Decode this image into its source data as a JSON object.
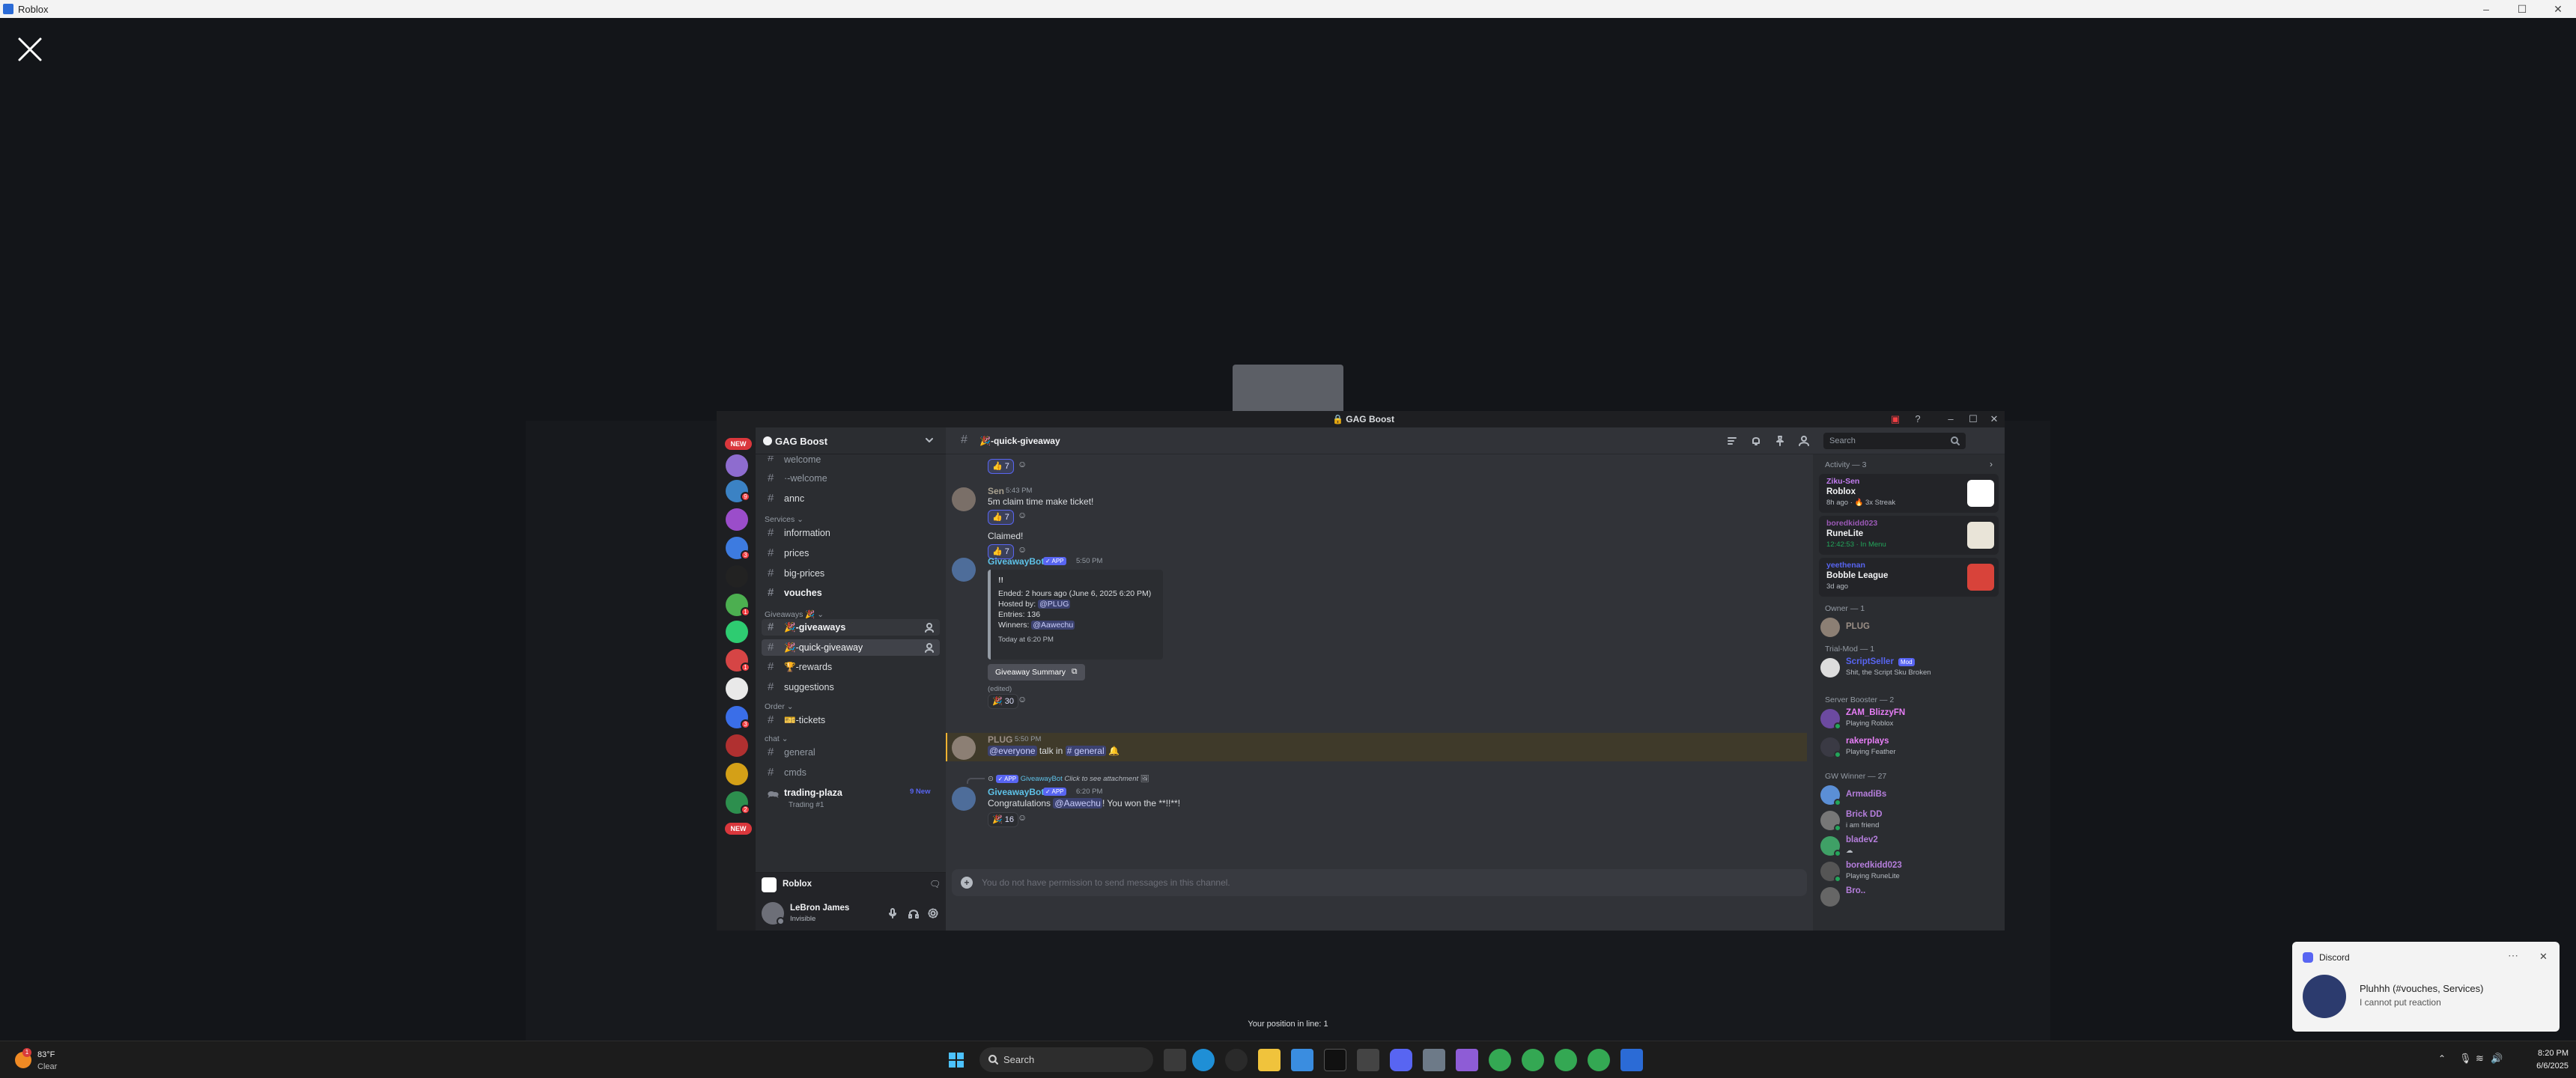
{
  "window": {
    "title": "Roblox",
    "close_glyph": "✕"
  },
  "discord": {
    "title": "GAG Boost",
    "server_name": "GAG Boost",
    "rail_new_label": "NEW",
    "rail_badges": [
      "9",
      "3",
      "1",
      "1",
      "3",
      "2",
      "1"
    ],
    "sidebar": {
      "channels_top": [
        {
          "name": "welcome",
          "faded": true
        },
        {
          "name": "·-welcome",
          "faded": true
        },
        {
          "name": "annc",
          "faded": false
        }
      ],
      "cat_services": "Services ⌄",
      "services": [
        "information",
        "prices",
        "big-prices",
        "vouches"
      ],
      "cat_giveaways": "Giveaways 🎉 ⌄",
      "giveaways": [
        "🎉-giveaways",
        "🎉-quick-giveaway",
        "🏆-rewards",
        "suggestions"
      ],
      "cat_order": "Order ⌄",
      "order": [
        "🎫-tickets"
      ],
      "cat_chat": "chat ⌄",
      "chat": [
        "general",
        "cmds",
        "trading-plaza",
        "Trading #1"
      ],
      "trading_new": "9 New"
    },
    "voice": {
      "label": "Roblox"
    },
    "user": {
      "name": "LeBron James",
      "status": "Invisible"
    },
    "channel_header": {
      "name": "🎉-quick-giveaway",
      "search_placeholder": "Search"
    },
    "messages": {
      "top_reaction": "7",
      "m1": {
        "name": "Sen",
        "time": "5:43 PM",
        "text": "5m claim time make ticket!",
        "reaction": "7"
      },
      "m1b": {
        "text": "Claimed!",
        "reaction": "7"
      },
      "m2": {
        "name": "GiveawayBot",
        "app": "✓ APP",
        "time": "5:50 PM",
        "embed_title": "!!",
        "ended": "Ended: 2 hours ago (June 6, 2025 6:20 PM)",
        "hosted_label": "Hosted by:",
        "hosted": "@PLUG",
        "entries": "Entries: 136",
        "winners_label": "Winners:",
        "winners": "@Aawechu",
        "today": "Today at 6:20 PM",
        "button": "Giveaway Summary",
        "edited": "(edited)",
        "reaction": "30"
      },
      "m3": {
        "name": "PLUG",
        "time": "5:50 PM",
        "mention": "@everyone",
        "text1": "talk in",
        "channel": "# general",
        "emoji": "🔔"
      },
      "m4": {
        "reply_name": "GiveawayBot",
        "reply_app": "✓ APP",
        "reply_text": "Click to see attachment",
        "name": "GiveawayBot",
        "app": "✓ APP",
        "time": "6:20 PM",
        "text1": "Congratulations",
        "mention": "@Aawechu",
        "text2": "! You won the **!!**!",
        "reaction": "16"
      }
    },
    "input_placeholder": "You do not have permission to send messages in this channel.",
    "members": {
      "activity_header": "Activity — 3",
      "activities": [
        {
          "name": "Ziku-Sen",
          "game": "Roblox",
          "meta": "8h ago · 🔥 3x Streak",
          "color": "#c27cf0"
        },
        {
          "name": "boredkidd023",
          "game": "RuneLite",
          "meta": "12:42:53 · In Menu",
          "color": "#9b59b6"
        },
        {
          "name": "yeethenan",
          "game": "Bobble League",
          "meta": "3d ago",
          "color": "#5865f2"
        }
      ],
      "owner_header": "Owner — 1",
      "owner": {
        "name": "PLUG",
        "color": "#9b8f86"
      },
      "trial_header": "Trial-Mod — 1",
      "trial": {
        "name": "ScriptSeller",
        "tag": "Mod",
        "status": "Shit, the Script Sku Broken"
      },
      "booster_header": "Server Booster — 2",
      "boosters": [
        {
          "name": "ZAM_BlizzyFN",
          "status": "Playing Roblox",
          "color": "#e87ef7"
        },
        {
          "name": "rakerplays",
          "status": "Playing Feather",
          "color": "#e87ef7"
        }
      ],
      "gw_header": "GW Winner — 27",
      "winners": [
        {
          "name": "ArmadiBs",
          "status": "",
          "color": "#b57edc"
        },
        {
          "name": "Brick DD",
          "status": "i am friend",
          "color": "#b57edc"
        },
        {
          "name": "bladev2",
          "status": "☁",
          "color": "#b57edc"
        },
        {
          "name": "boredkidd023",
          "status": "Playing RuneLite",
          "color": "#b57edc"
        },
        {
          "name": "Bro..",
          "status": "",
          "color": "#b57edc"
        }
      ]
    }
  },
  "queue_text": "Your position in line: 1",
  "toast": {
    "app": "Discord",
    "title": "Pluhhh (#vouches, Services)",
    "body": "I cannot put reaction",
    "dots": "⋯",
    "close": "✕"
  },
  "taskbar": {
    "weather_temp": "83°F",
    "weather_desc": "Clear",
    "weather_badge": "1",
    "search_label": "Search",
    "time": "8:20 PM",
    "date": "6/6/2025"
  },
  "colors": {
    "accent": "#5865f2",
    "bg": "#313338",
    "sidebar": "#2b2d31",
    "rail": "#1e1f22",
    "danger": "#da373c"
  }
}
